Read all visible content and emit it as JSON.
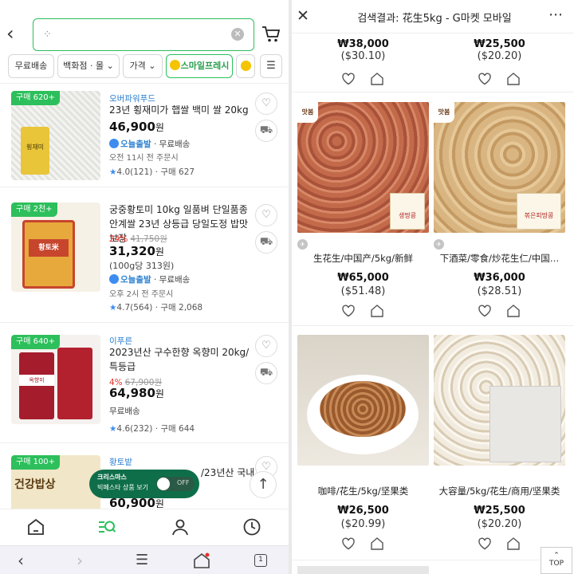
{
  "left": {
    "search": {
      "value": ""
    },
    "filters": [
      "무료배송",
      "백화점 · 몰",
      "가격",
      "스마일프레시"
    ],
    "products": [
      {
        "badge": "구매 620+",
        "brand": "오버파워푸드",
        "name": "23년 횡재미가 햅쌀 백미 쌀 20kg",
        "price": "46,900",
        "won": "원",
        "delivery": "오늘출발",
        "shipping": "· 무료배송",
        "order_time": "오전 11시 전 주문시",
        "rating": "4.0",
        "reviews": "(121)",
        "purchases": "· 구매 627",
        "thumb_text": "횡재미"
      },
      {
        "badge": "구매 2천+",
        "name": "궁중황토미 10kg 일품벼 단일품종 안계쌀 23년 상등급 당일도정 밥맛보장",
        "discount": "24%",
        "old_price": "41,750원",
        "price": "31,320",
        "won": "원",
        "unit_price": "(100g당 313원)",
        "delivery": "오늘출발",
        "shipping": "· 무료배송",
        "order_time": "오후 2시 전 주문시",
        "rating": "4.7",
        "reviews": "(564)",
        "purchases": "· 구매 2,068",
        "thumb_text": "황토米"
      },
      {
        "badge": "구매 640+",
        "brand": "이푸른",
        "name": "2023년산 구수한향 옥향미 20kg/특등급",
        "discount": "4%",
        "old_price": "67,900원",
        "price": "64,980",
        "won": "원",
        "shipping": "무료배송",
        "rating": "4.6",
        "reviews": "(232)",
        "purchases": "· 구매 644",
        "thumb_text": "옥향미"
      },
      {
        "badge": "구매 100+",
        "brand": "황토밭",
        "name": "/23년산 국내",
        "price": "60,900",
        "won": "원",
        "thumb_text": "건강밥상"
      }
    ],
    "floating": {
      "line1": "크리스마스",
      "line2": "빅페스타 상품 보기",
      "toggle": "OFF"
    },
    "browser": {
      "tab_count": "1"
    }
  },
  "right": {
    "title": "검색결과: 花生5kg - G마켓 모바일",
    "top_prices": [
      {
        "krw": "₩38,000",
        "usd": "($30.10)"
      },
      {
        "krw": "₩25,500",
        "usd": "($20.20)"
      }
    ],
    "items": [
      {
        "name": "生花生/中国产/5kg/新鲜",
        "krw": "₩65,000",
        "usd": "($51.48)",
        "label": "생땅콩",
        "logo": "맛봄"
      },
      {
        "name": "下酒菜/零食/炒花生仁/中国…",
        "krw": "₩36,000",
        "usd": "($28.51)",
        "label": "볶은피땅콩",
        "logo": "맛봄"
      },
      {
        "name": "咖啡/花生/5kg/坚果类",
        "krw": "₩26,500",
        "usd": "($20.99)"
      },
      {
        "name": "大容量/5kg/花生/商用/坚果类",
        "krw": "₩25,500",
        "usd": "($20.20)"
      }
    ],
    "top_button": "TOP"
  }
}
